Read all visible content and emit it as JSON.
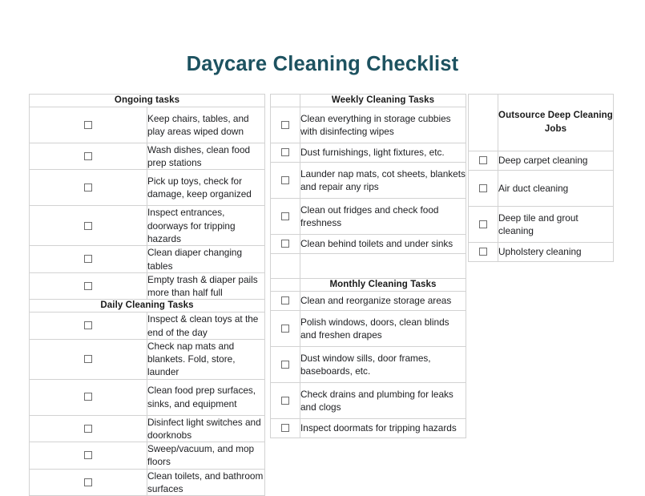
{
  "document": {
    "title": "Daycare Cleaning Checklist",
    "title_color": "#1d5260",
    "header_bg": "#d9d9d9",
    "checkbox_icon": "empty-checkbox-icon"
  },
  "columns": {
    "left": {
      "sections": [
        {
          "header": "Ongoing tasks",
          "header_spans_checkbox": true,
          "items": [
            {
              "label": "Keep chairs, tables, and play areas wiped down",
              "lines": 2,
              "checked": false
            },
            {
              "label": "Wash dishes, clean food prep stations",
              "lines": 1,
              "checked": false
            },
            {
              "label": "Pick up toys, check for damage, keep organized",
              "lines": 2,
              "checked": false
            },
            {
              "label": "Inspect entrances, doorways for tripping hazards",
              "lines": 2,
              "checked": false
            },
            {
              "label": "Clean diaper changing tables",
              "lines": 1,
              "checked": false
            },
            {
              "label": "Empty trash & diaper pails more than half full",
              "lines": 1,
              "checked": false
            }
          ]
        },
        {
          "header": "Daily Cleaning Tasks",
          "header_spans_checkbox": true,
          "items": [
            {
              "label": "Inspect & clean toys at the end of the day",
              "lines": 1,
              "checked": false
            },
            {
              "label": "Check nap mats and blankets. Fold, store, launder",
              "lines": 2,
              "checked": false
            },
            {
              "label": "Clean food prep surfaces, sinks, and equipment",
              "lines": 2,
              "checked": false
            },
            {
              "label": "Disinfect light switches and doorknobs",
              "lines": 1,
              "checked": false
            },
            {
              "label": "Sweep/vacuum, and mop floors",
              "lines": 1,
              "checked": false
            },
            {
              "label": "Clean toilets, and bathroom surfaces",
              "lines": 1,
              "checked": false
            }
          ]
        }
      ]
    },
    "middle": {
      "sections": [
        {
          "header": "Weekly Cleaning Tasks",
          "header_spans_checkbox": false,
          "items": [
            {
              "label": "Clean everything in storage cubbies with disinfecting wipes",
              "lines": 2,
              "checked": false
            },
            {
              "label": "Dust furnishings, light fixtures, etc.",
              "lines": 1,
              "checked": false
            },
            {
              "label": "Launder nap mats, cot sheets, blankets and repair any rips",
              "lines": 2,
              "checked": false
            },
            {
              "label": "Clean out fridges and check food freshness",
              "lines": 2,
              "checked": false
            },
            {
              "label": "Clean behind toilets and under sinks",
              "lines": 1,
              "checked": false
            }
          ]
        },
        {
          "header": "Monthly Cleaning Tasks",
          "header_spans_checkbox": false,
          "items": [
            {
              "label": "Clean and reorganize storage areas",
              "lines": 1,
              "checked": false
            },
            {
              "label": "Polish windows, doors, clean blinds and freshen drapes",
              "lines": 2,
              "checked": false
            },
            {
              "label": "Dust window sills, door frames, baseboards, etc.",
              "lines": 2,
              "checked": false
            },
            {
              "label": "Check drains and plumbing for leaks and clogs",
              "lines": 2,
              "checked": false
            },
            {
              "label": "Inspect doormats for tripping hazards",
              "lines": 1,
              "checked": false
            }
          ]
        }
      ]
    },
    "right": {
      "sections": [
        {
          "header": "Outsource Deep Cleaning Jobs",
          "header_spans_checkbox": false,
          "items": [
            {
              "label": "Deep carpet cleaning",
              "lines": 1,
              "checked": false
            },
            {
              "label": "Air duct cleaning",
              "lines": 1,
              "checked": false
            },
            {
              "label": "Deep tile and grout cleaning",
              "lines": 2,
              "checked": false
            },
            {
              "label": "Upholstery cleaning",
              "lines": 1,
              "checked": false
            }
          ]
        }
      ]
    }
  }
}
